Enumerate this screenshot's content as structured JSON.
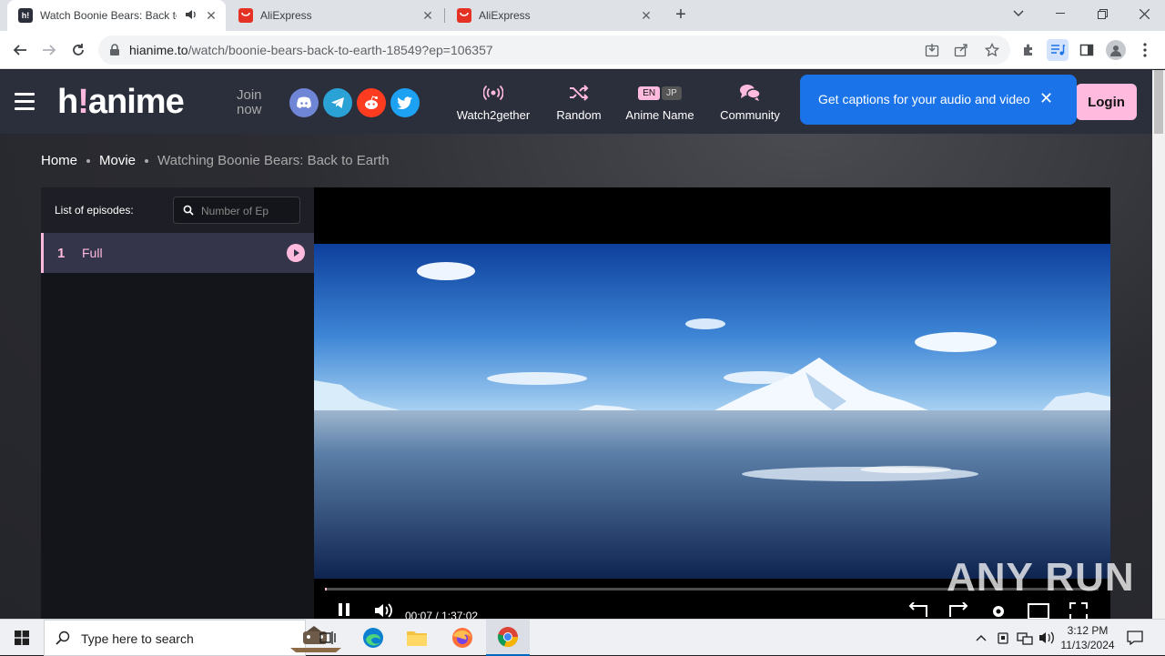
{
  "browser": {
    "tabs": [
      {
        "title": "Watch Boonie Bears: Back to Earth",
        "favicon_text": "h!",
        "favicon_color": "#2b2e3b",
        "active": true
      },
      {
        "title": "AliExpress",
        "favicon_text": "",
        "favicon_color": "#e43225",
        "active": false
      },
      {
        "title": "AliExpress",
        "favicon_text": "",
        "favicon_color": "#e43225",
        "active": false
      }
    ],
    "url_host": "hianime.to",
    "url_path": "/watch/boonie-bears-back-to-earth-18549?ep=106357"
  },
  "site": {
    "logo_main": "h",
    "logo_bang": "!",
    "logo_rest": "anime",
    "join_line1": "Join",
    "join_line2": "now",
    "social": [
      {
        "icon": "discord-icon",
        "color": "#6f85d5"
      },
      {
        "icon": "telegram-icon",
        "color": "#2aa2d6"
      },
      {
        "icon": "reddit-icon",
        "color": "#ff3c1f"
      },
      {
        "icon": "twitter-icon",
        "color": "#1da1f2"
      }
    ],
    "nav": {
      "watch2gether": "Watch2gether",
      "random": "Random",
      "anime_name": "Anime Name",
      "lang_en": "EN",
      "lang_jp": "JP",
      "community": "Community"
    },
    "login": "Login",
    "accent": "#ffbade"
  },
  "captions_popup": {
    "text": "Get captions for your audio and video",
    "close": "✕"
  },
  "breadcrumb": {
    "home": "Home",
    "movie": "Movie",
    "current": "Watching Boonie Bears: Back to Earth"
  },
  "episodes": {
    "header": "List of episodes:",
    "search_placeholder": "Number of Ep",
    "items": [
      {
        "number": "1",
        "title": "Full"
      }
    ]
  },
  "player": {
    "current_time": "00:07",
    "separator": "/",
    "duration": "1:37:02",
    "progress_fraction": 0.0012
  },
  "watermark": "ANY RUN",
  "taskbar": {
    "search_placeholder": "Type here to search",
    "time": "3:12 PM",
    "date": "11/13/2024"
  }
}
